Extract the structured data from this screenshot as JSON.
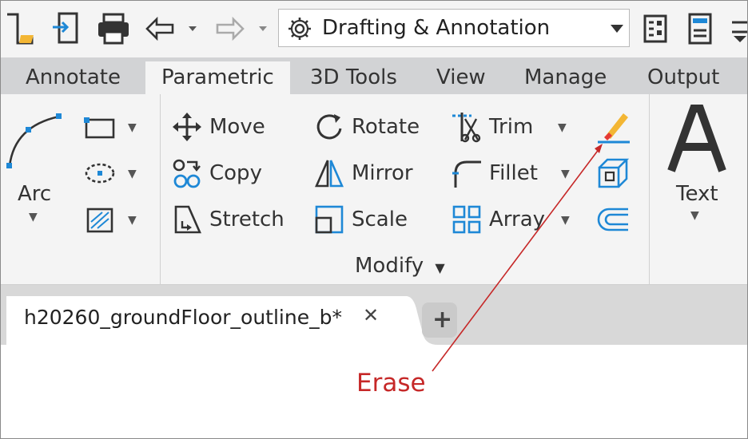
{
  "workspace": {
    "label": "Drafting & Annotation"
  },
  "ribbon_tabs": [
    "Annotate",
    "Parametric",
    "3D Tools",
    "View",
    "Manage",
    "Output"
  ],
  "draw_panel": {
    "arc_label": "Arc"
  },
  "modify_panel": {
    "title": "Modify",
    "move": "Move",
    "rotate": "Rotate",
    "trim": "Trim",
    "copy": "Copy",
    "mirror": "Mirror",
    "fillet": "Fillet",
    "stretch": "Stretch",
    "scale": "Scale",
    "array": "Array"
  },
  "annotation_panel": {
    "text_label": "Text"
  },
  "document_tab": {
    "title": "h20260_groundFloor_outline_b*",
    "close": "✕",
    "new_tab": "+"
  },
  "callout": {
    "label": "Erase"
  },
  "colors": {
    "accent": "#1e88d6",
    "callout": "#c62828"
  }
}
